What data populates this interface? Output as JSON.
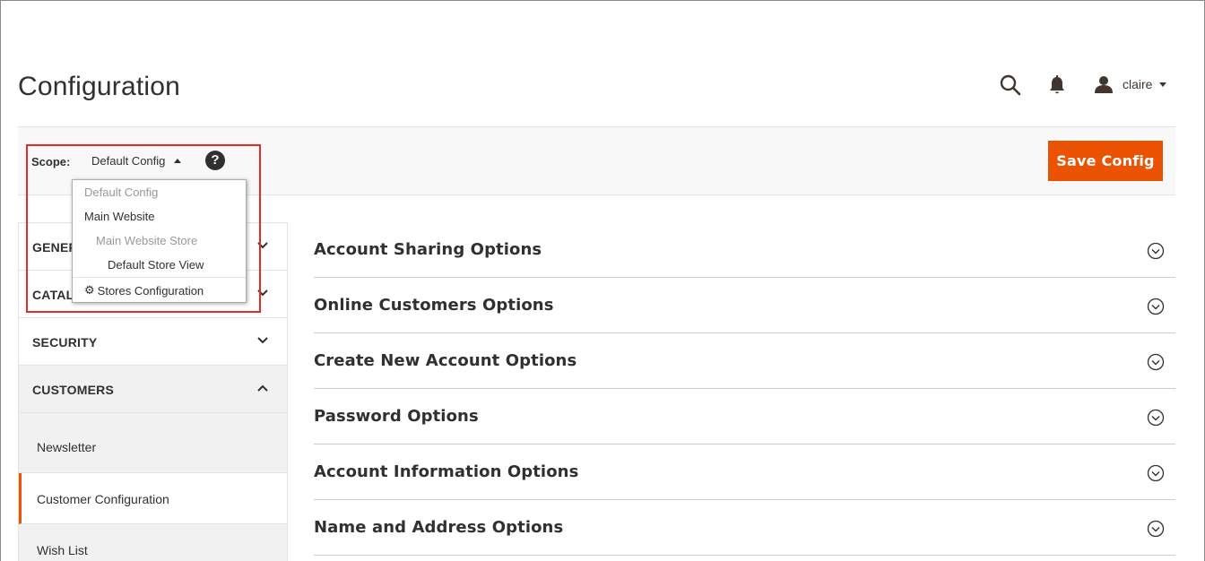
{
  "page": {
    "title": "Configuration"
  },
  "header": {
    "search_icon": "search-icon",
    "notifications_icon": "bell-icon",
    "user_icon": "user-icon",
    "user_name": "claire"
  },
  "actions_bar": {
    "scope_label": "Scope:",
    "scope_value": "Default Config",
    "help_icon": "?",
    "save_button_label": "Save Config"
  },
  "scope_dropdown": {
    "options": [
      {
        "label": "Default Config",
        "disabled": true,
        "level": 1
      },
      {
        "label": "Main Website",
        "disabled": false,
        "level": 1
      },
      {
        "label": "Main Website Store",
        "disabled": true,
        "level": 2
      },
      {
        "label": "Default Store View",
        "disabled": false,
        "level": 3
      }
    ],
    "stores_configuration_label": "Stores Configuration"
  },
  "sidebar": {
    "sections": [
      {
        "label": "GENERAL",
        "expanded": false
      },
      {
        "label": "CATALOG",
        "expanded": false
      },
      {
        "label": "SECURITY",
        "expanded": false
      },
      {
        "label": "CUSTOMERS",
        "expanded": true
      }
    ],
    "customers_items": [
      {
        "label": "Newsletter",
        "active": false
      },
      {
        "label": "Customer Configuration",
        "active": true
      },
      {
        "label": "Wish List",
        "active": false
      }
    ]
  },
  "main": {
    "sections": [
      {
        "title": "Account Sharing Options"
      },
      {
        "title": "Online Customers Options"
      },
      {
        "title": "Create New Account Options"
      },
      {
        "title": "Password Options"
      },
      {
        "title": "Account Information Options"
      },
      {
        "title": "Name and Address Options"
      }
    ]
  },
  "colors": {
    "accent": "#eb5202",
    "highlight": "#e02b27"
  }
}
